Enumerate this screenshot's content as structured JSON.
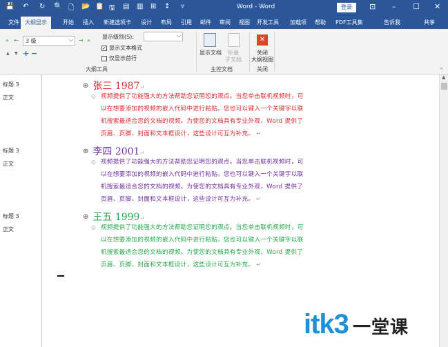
{
  "window": {
    "title": "Word - Word",
    "login": "登录",
    "quick_access": [
      "💾",
      "↶",
      "↻",
      "🔍",
      "🗋",
      "📂",
      "📋",
      "🖫",
      "▤",
      "▥",
      "⊞",
      "↕",
      "▿"
    ]
  },
  "tabs": [
    "文件",
    "大纲显示",
    "开始",
    "插入",
    "新建选项卡",
    "设计",
    "布局",
    "引用",
    "邮件",
    "审阅",
    "视图",
    "开发工具",
    "加载项",
    "帮助",
    "PDF工具集",
    "告诉我",
    "共享"
  ],
  "ribbon": {
    "level_value": "3 级",
    "show_level_label": "显示级别(S):",
    "show_level_value": "",
    "show_text_format": "显示文本格式",
    "show_text_format_checked": true,
    "first_line_only": "仅显示首行",
    "first_line_only_checked": false,
    "group_outline": "大纲工具",
    "show_document": "显示文档",
    "collapse_sub_1": "折叠",
    "collapse_sub_2": "子文档",
    "group_master": "主控文档",
    "close_1": "关闭",
    "close_2": "大纲视图",
    "group_close": "关闭"
  },
  "style_pane": [
    {
      "heading": "标题 3",
      "body": "正文"
    },
    {
      "heading": "标题 3",
      "body": "正文"
    },
    {
      "heading": "标题 3",
      "body": "正文"
    }
  ],
  "entries": [
    {
      "heading": "张三 1987",
      "color": "#e0282e",
      "lines": [
        "视频提供了功能强大的方法帮助您证明您的观点。当您单击联机视频时，可",
        "以在想要添加的视频的嵌入代码中进行粘贴。您也可以键入一个关键字以联",
        "机搜索最适合您的文档的视频。为使您的文档具有专业外观，Word 提供了",
        "页眉、页脚、封面和文本框设计，这些设计可互为补充。"
      ]
    },
    {
      "heading": "李四 2001",
      "color": "#7030a0",
      "lines": [
        "视频提供了功能强大的方法帮助您证明您的观点。当您单击联机视频时，可",
        "以在想要添加的视频的嵌入代码中进行粘贴。您也可以键入一个关键字以联",
        "机搜索最适合您的文档的视频。为使您的文档具有专业外观，Word 提供了",
        "页眉、页脚、封面和文本框设计，这些设计可互为补充。"
      ]
    },
    {
      "heading": "王五 1999",
      "color": "#22a84a",
      "lines": [
        "视频提供了功能强大的方法帮助您证明您的观点。当您单击联机视频时，可",
        "以在想要添加的视频的嵌入代码中进行粘贴。您也可以键入一个关键字以联",
        "机搜索最适合您的文档的视频。为使您的文档具有专业外观，Word 提供了",
        "页眉、页脚、封面和文本框设计，这些设计可互为补充。"
      ]
    }
  ],
  "watermark": {
    "brand": "itk3",
    "cn": "一堂课"
  }
}
